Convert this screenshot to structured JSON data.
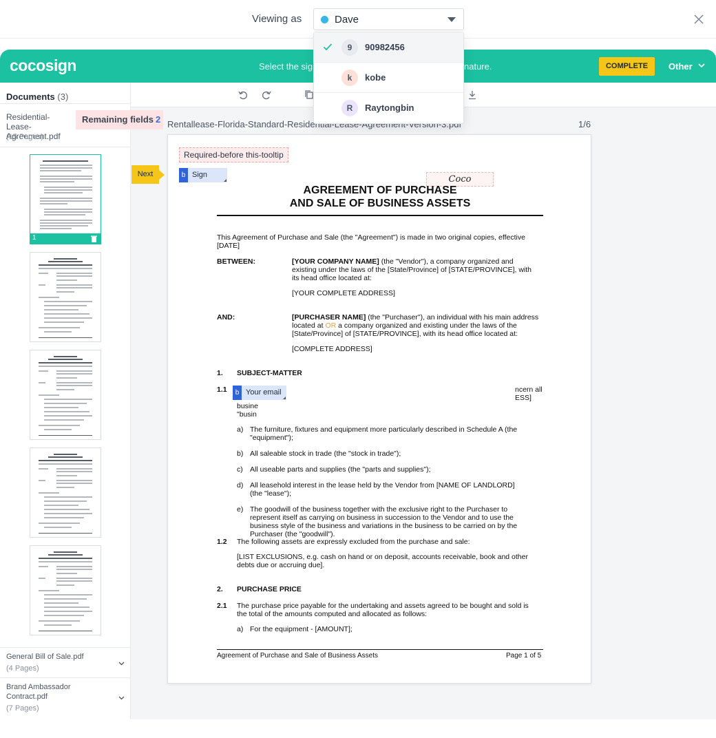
{
  "topbar": {
    "viewing_label": "Viewing as",
    "selected_viewer": "Dave",
    "viewer_dot_color": "#36b7e8"
  },
  "dropdown": {
    "items": [
      {
        "avatar": "9",
        "label": "90982456",
        "avatar_color": "#e7ebef",
        "selected": true
      },
      {
        "avatar": "k",
        "label": "kobe",
        "avatar_color": "#fde1d8",
        "selected": false
      },
      {
        "avatar": "R",
        "label": "Raytongbin",
        "avatar_color": "#ece4fb",
        "selected": false
      }
    ]
  },
  "app": {
    "logo": "cocosign",
    "message_left": "Select the sig",
    "message_right": "nature.",
    "complete_label": "COMPLETE",
    "other_label": "Other",
    "brand_color": "#1cc1a1",
    "complete_color": "#f5c518"
  },
  "sidebar": {
    "documents_label": "Documents",
    "documents_count": "(3)",
    "current_doc": {
      "name": "Residential-Lease-Agreement.pdf",
      "pages": "(15 Pages)"
    },
    "remaining_label": "Remaining fields",
    "remaining_count": "2",
    "active_thumb_number": "1",
    "other_docs": [
      {
        "name": "General Bill of Sale.pdf",
        "pages": "(4 Pages)"
      },
      {
        "name": "Brand Ambassador Contract.pdf",
        "pages": "(7 Pages)"
      }
    ]
  },
  "viewer": {
    "filename": "Rentallease-Florida-Standard-Residential-Lease-Agreement-Version-3.pdf",
    "page_indicator": "1/6",
    "next_label": "Next"
  },
  "page": {
    "required_tooltip": "Required-before this-tooltip",
    "sign_field_label": "Sign",
    "field_badge": "b",
    "signature_text": "Coco",
    "email_field_label": "Your email",
    "title_line1": "AGREEMENT OF PURCHASE",
    "title_line2": "AND SALE OF BUSINESS ASSETS",
    "intro": "This Agreement of Purchase and Sale (the \"Agreement\") is made in two original copies, effective [DATE]",
    "between_label": "BETWEEN:",
    "between_bold": "[YOUR COMPANY NAME]",
    "between_rest": " (the \"Vendor\"), a company organized and existing under the laws of the [State/Province] of [STATE/PROVINCE], with its head office located at:",
    "between_address": "[YOUR COMPLETE ADDRESS]",
    "and_label": "AND:",
    "and_bold": "[PURCHASER NAME]",
    "and_rest1": " (the \"Purchaser\"), an individual with his main address located at ",
    "and_or": "OR",
    "and_rest2": " a company organized and existing under the laws of the [State/Province] of [STATE/PROVINCE], with its head office located at:",
    "and_address": "[COMPLETE ADDRESS]",
    "s1_num": "1.",
    "s1_title": "SUBJECT-MATTER",
    "s11_num": "1.1",
    "s11_right1": "ncern all",
    "s11_right2": "ESS]",
    "s11_left1": "busine",
    "s11_left2": "\"busin",
    "items": [
      {
        "letter": "a)",
        "text": "The furniture, fixtures and equipment more particularly described in Schedule A (the \"equipment\");"
      },
      {
        "letter": "b)",
        "text": "All saleable stock in trade (the \"stock in trade\");"
      },
      {
        "letter": "c)",
        "text": "All useable parts and supplies (the \"parts and supplies\");"
      },
      {
        "letter": "d)",
        "text": "All leasehold interest in the lease held by the Vendor from [NAME OF LANDLORD] (the \"lease\");"
      },
      {
        "letter": "e)",
        "text": "The goodwill of the business together with the exclusive right to the Purchaser to represent itself as carrying on business in succession to the Vendor and to use the business style of the business and variations in the business to be carried on by the Purchaser (the \"goodwill\")."
      }
    ],
    "s12_num": "1.2",
    "s12_text": "The following assets are expressly excluded from the purchase and sale:",
    "s12_list": "[LIST EXCLUSIONS, e.g. cash on hand or on deposit, accounts receivable, book and other debts due or accruing due].",
    "s2_num": "2.",
    "s2_title": "PURCHASE PRICE",
    "s21_num": "2.1",
    "s21_text": "The purchase price payable for the undertaking and assets agreed to be bought and sold is the total of the amounts computed and allocated as follows:",
    "s21_item_letter": "a)",
    "s21_item_text": "For the equipment - [AMOUNT];",
    "footer_left": "Agreement of Purchase and Sale of Business Assets",
    "footer_right": "Page 1 of 5"
  }
}
